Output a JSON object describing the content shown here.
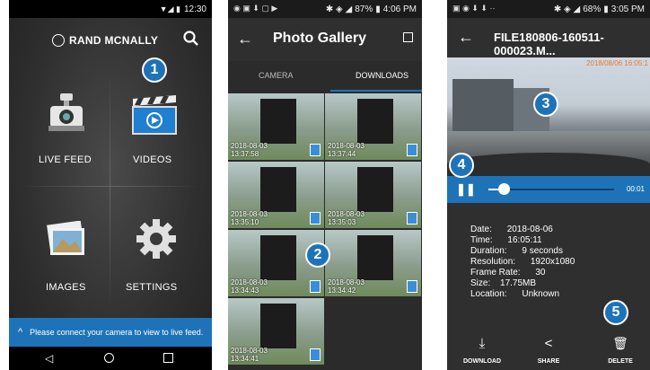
{
  "phone1": {
    "status": {
      "time": "12:30"
    },
    "brand": "RAND MCNALLY",
    "tiles": [
      {
        "label": "LIVE FEED"
      },
      {
        "label": "VIDEOS"
      },
      {
        "label": "IMAGES"
      },
      {
        "label": "SETTINGS"
      }
    ],
    "notice": "Please connect your camera to view to live feed.",
    "badge": "1"
  },
  "phone2": {
    "status": {
      "battery": "87%",
      "time": "4:06 PM"
    },
    "title": "Photo Gallery",
    "tabs": [
      {
        "label": "CAMERA"
      },
      {
        "label": "DOWNLOADS"
      }
    ],
    "thumbs": [
      {
        "date": "2018-08-03",
        "time": "13:37:58"
      },
      {
        "date": "2018-08-03",
        "time": "13:37:44"
      },
      {
        "date": "2018-08-03",
        "time": "13:35:10"
      },
      {
        "date": "2018-08-03",
        "time": "13:35:03"
      },
      {
        "date": "2018-08-03",
        "time": "13:34:43"
      },
      {
        "date": "2018-08-03",
        "time": "13:34:42"
      },
      {
        "date": "2018-08-03",
        "time": "13:34:41"
      }
    ],
    "badge": "2"
  },
  "phone3": {
    "status": {
      "battery": "68%",
      "time": "3:05 PM"
    },
    "title": "FILE180806-160511-000023.M...",
    "overlay_ts": "2018/08/06 16:05:1",
    "elapsed": "00:01",
    "progress": 0.12,
    "meta": [
      {
        "k": "Date:",
        "v": "2018-08-06"
      },
      {
        "k": "Time:",
        "v": "16:05:11"
      },
      {
        "k": "Duration:",
        "v": "9 seconds"
      },
      {
        "k": "Resolution:",
        "v": "1920x1080"
      },
      {
        "k": "Frame Rate:",
        "v": "30"
      },
      {
        "k": "Size:",
        "v": "17.75MB"
      },
      {
        "k": "Location:",
        "v": "Unknown"
      }
    ],
    "actions": [
      {
        "label": "DOWNLOAD"
      },
      {
        "label": "SHARE"
      },
      {
        "label": "DELETE"
      }
    ],
    "badges": [
      "3",
      "4",
      "5"
    ]
  }
}
